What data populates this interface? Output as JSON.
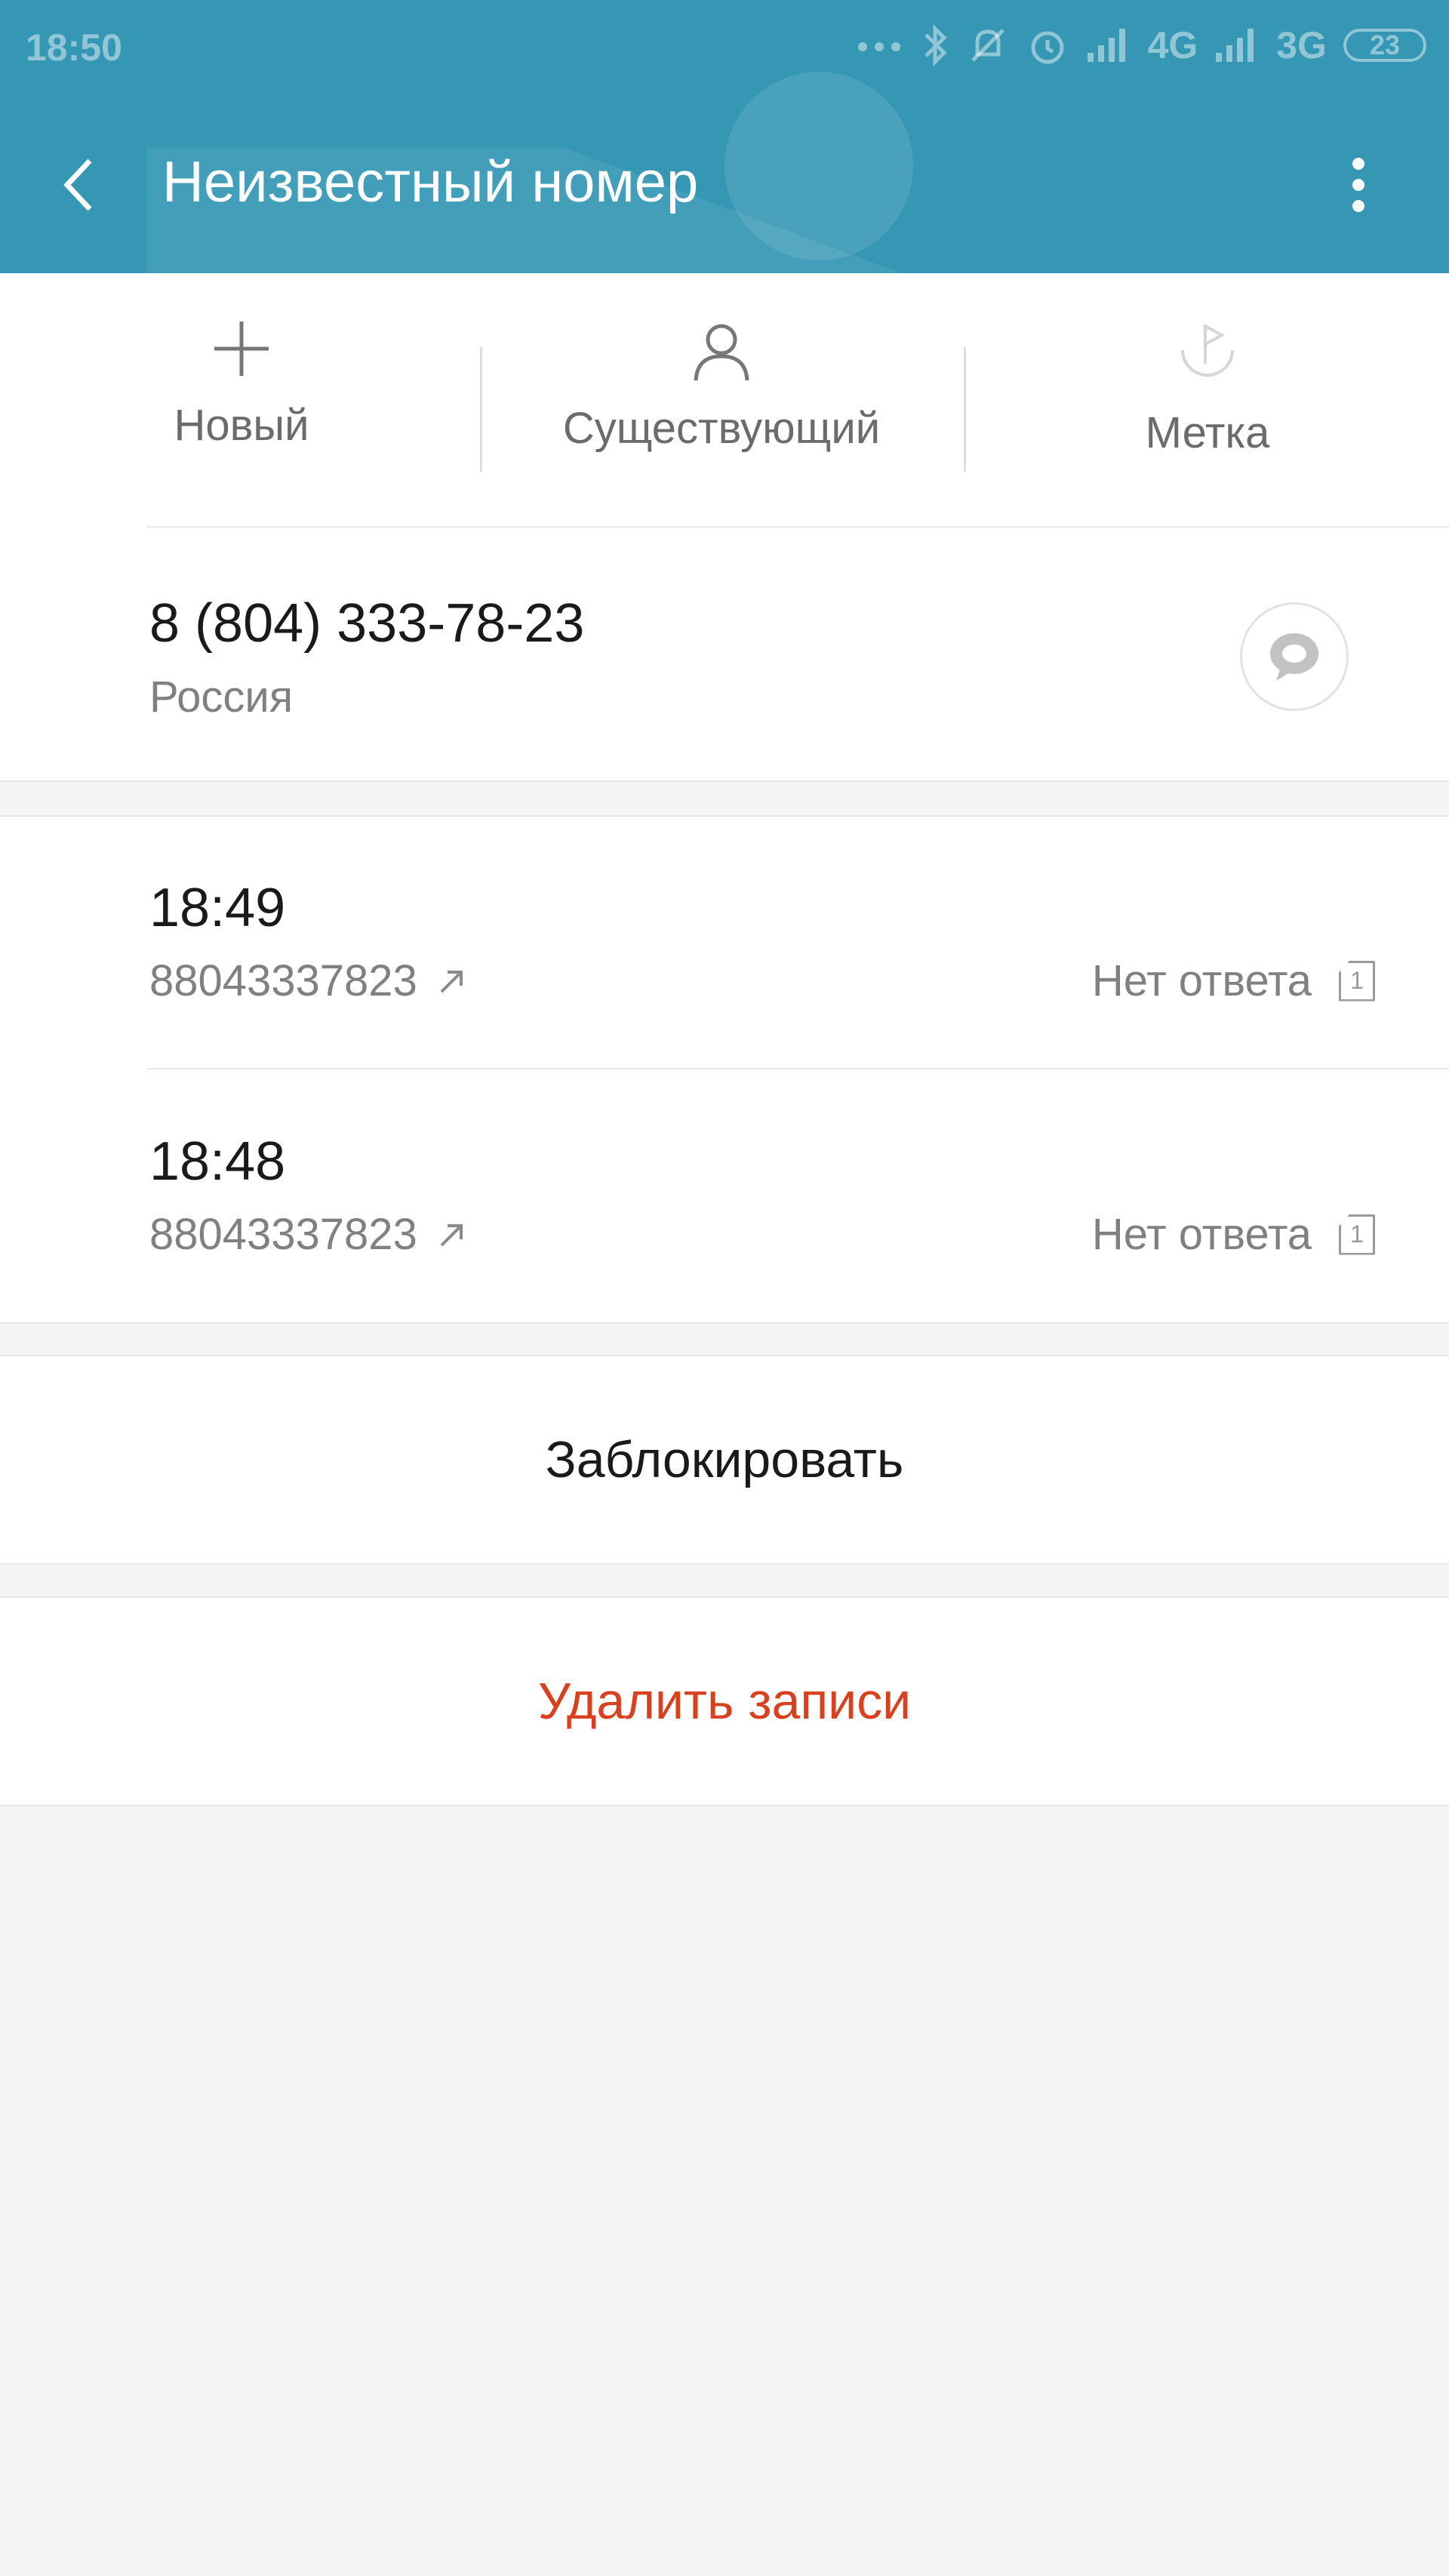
{
  "statusbar": {
    "time": "18:50",
    "network_1": "4G",
    "network_2": "3G",
    "battery": "23",
    "icons": [
      "dots-icon",
      "bluetooth-icon",
      "mute-icon",
      "alarm-icon",
      "signal-icon",
      "signal-icon"
    ]
  },
  "appbar": {
    "title": "Неизвестный номер",
    "back_icon": "chevron-left-icon",
    "more_icon": "more-vertical-icon",
    "color": "#3597b4"
  },
  "actions": [
    {
      "label": "Новый",
      "icon": "plus-icon"
    },
    {
      "label": "Существующий",
      "icon": "person-icon"
    },
    {
      "label": "Метка",
      "icon": "flag-icon"
    }
  ],
  "contact": {
    "phone": "8 (804) 333-78-23",
    "country": "Россия",
    "message_icon": "message-bubble-icon"
  },
  "call_log": [
    {
      "time": "18:49",
      "number": "88043337823",
      "direction_icon": "outgoing-arrow-icon",
      "status": "Нет ответа",
      "sim": "1"
    },
    {
      "time": "18:48",
      "number": "88043337823",
      "direction_icon": "outgoing-arrow-icon",
      "status": "Нет ответа",
      "sim": "1"
    }
  ],
  "block_label": "Заблокировать",
  "delete_label": "Удалить записи",
  "delete_color": "#d9401e"
}
